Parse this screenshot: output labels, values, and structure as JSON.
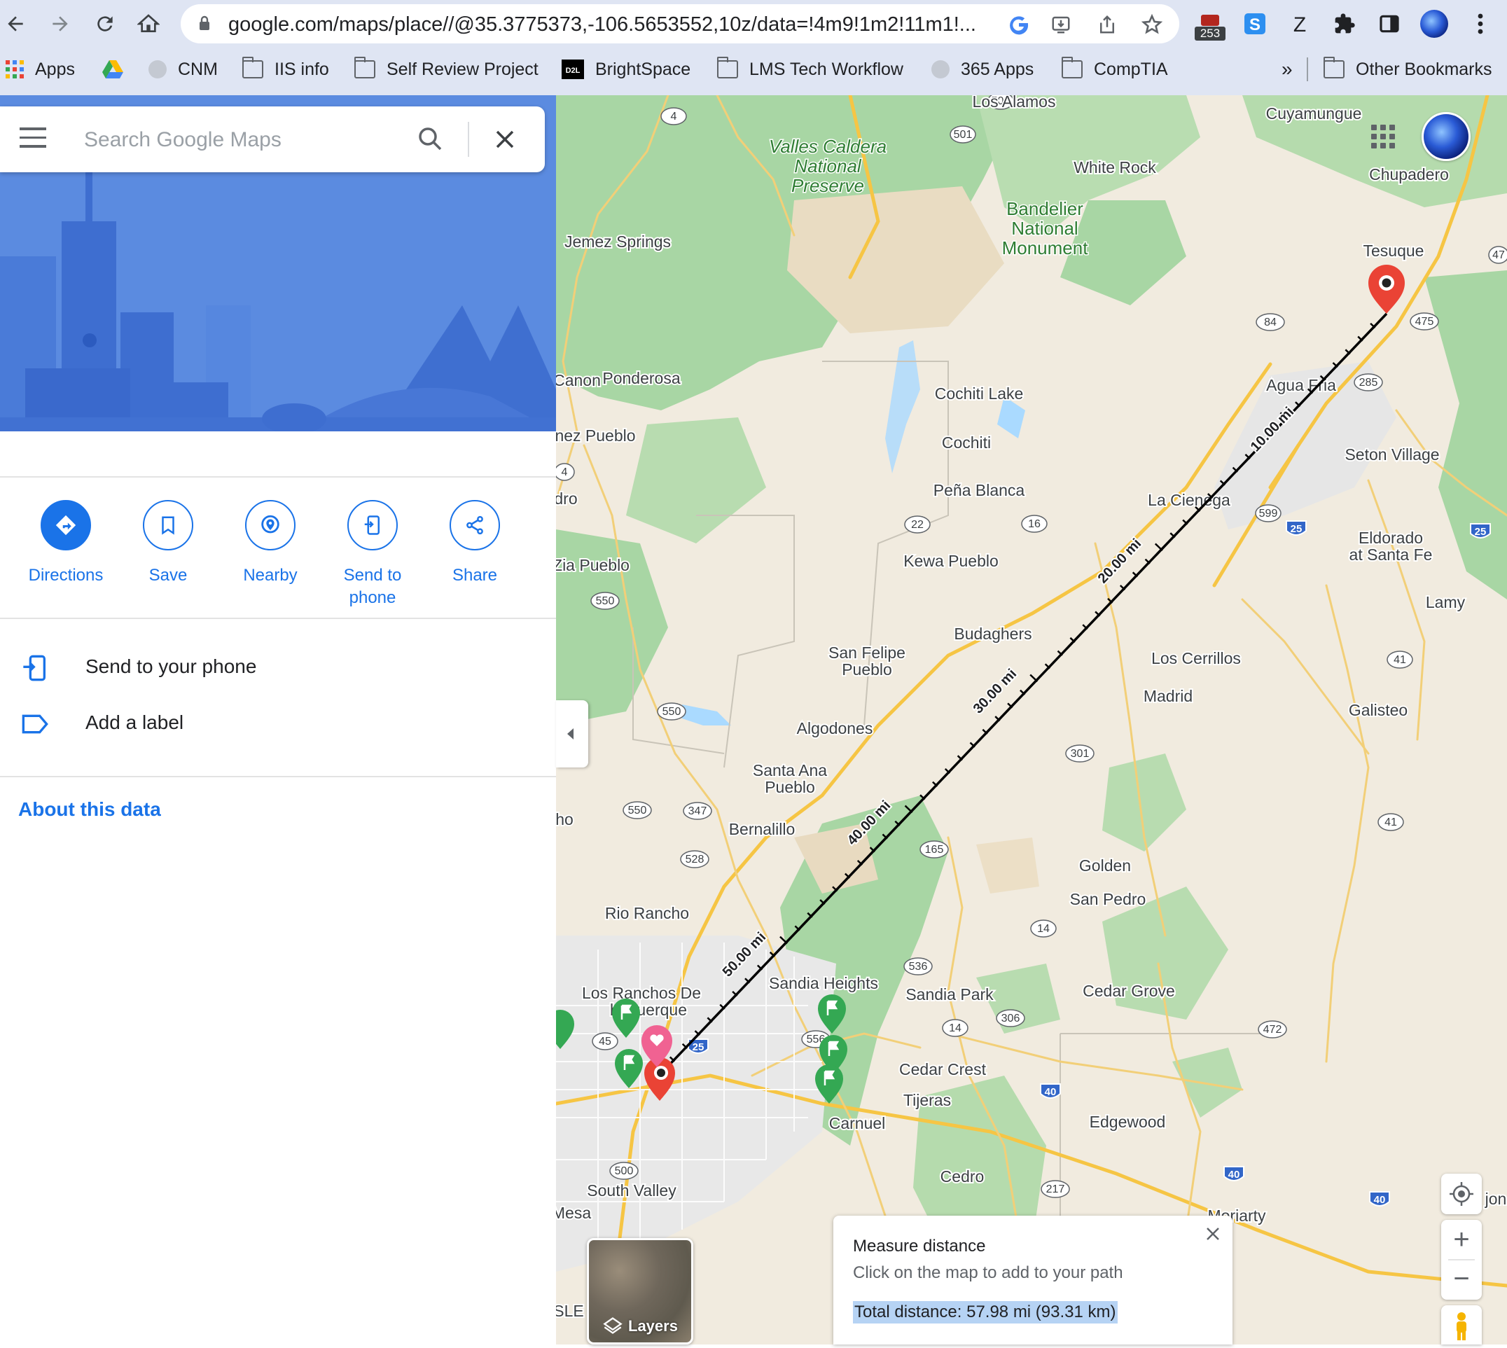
{
  "browser": {
    "url": "google.com/maps/place//@35.3775373,-106.5653552,10z/data=!4m9!1m2!11m1!...",
    "extension_badge": "253",
    "bookmarks": [
      {
        "label": "Apps",
        "icon": "apps-grid-icon"
      },
      {
        "label": "",
        "icon": "google-drive-icon"
      },
      {
        "label": "CNM",
        "icon": "globe-icon"
      },
      {
        "label": "IIS info",
        "icon": "folder-icon"
      },
      {
        "label": "Self Review Project",
        "icon": "folder-icon"
      },
      {
        "label": "BrightSpace",
        "icon": "d2l-icon"
      },
      {
        "label": "LMS Tech Workflow",
        "icon": "folder-icon"
      },
      {
        "label": "365 Apps",
        "icon": "globe-icon"
      },
      {
        "label": "CompTIA",
        "icon": "folder-icon"
      }
    ],
    "overflow": "»",
    "other_bookmarks": "Other Bookmarks"
  },
  "panel": {
    "search_placeholder": "Search Google Maps",
    "actions": [
      {
        "label": "Directions",
        "icon": "directions-icon"
      },
      {
        "label": "Save",
        "icon": "bookmark-icon"
      },
      {
        "label": "Nearby",
        "icon": "nearby-icon"
      },
      {
        "label": "Send to\nphone",
        "icon": "send-to-phone-icon"
      },
      {
        "label": "Share",
        "icon": "share-icon"
      }
    ],
    "list": [
      {
        "label": "Send to your phone",
        "icon": "phone-icon"
      },
      {
        "label": "Add a label",
        "icon": "label-icon"
      }
    ],
    "about": "About this data"
  },
  "map": {
    "places": [
      "Los Alamos",
      "Cuyamungue",
      "White Rock",
      "Chupadero",
      "Jemez Springs",
      "Tesuque",
      "Canon",
      "Ponderosa",
      "Agua Fria",
      "Cochiti Lake",
      "Cochiti",
      "nez Pueblo",
      "Seton Village",
      "Peña Blanca",
      "La Cienega",
      "dro",
      "Eldorado",
      "at Santa Fe",
      "Kewa Pueblo",
      "Zia Pueblo",
      "Lamy",
      "Budaghers",
      "San Felipe",
      "Pueblo",
      "Los Cerrillos",
      "Madrid",
      "Galisteo",
      "Algodones",
      "Santa Ana",
      "Pueblo",
      "Bernalillo",
      "ho",
      "Golden",
      "San Pedro",
      "Rio Rancho",
      "Cedar Grove",
      "Los Ranchos De",
      "buquerque",
      "Sandia Heights",
      "Sandia Park",
      "Cedar Crest",
      "Tijeras",
      "Carnuel",
      "Edgewood",
      "Cedro",
      "South Valley",
      "Moriarty",
      "Mesa",
      "jon",
      "SLE"
    ],
    "parks": [
      "Valles Caldera",
      "National",
      "Preserve",
      "Bandelier",
      "National",
      "Monument"
    ],
    "distance_labels": [
      "10.00 mi",
      "20.00 mi",
      "30.00 mi",
      "40.00 mi",
      "50.00 mi"
    ],
    "measure": {
      "title": "Measure distance",
      "hint": "Click on the map to add to your path",
      "total": "Total distance: 57.98 mi (93.31 km)"
    },
    "layers_label": "Layers",
    "zoom_in": "+",
    "zoom_out": "−"
  }
}
